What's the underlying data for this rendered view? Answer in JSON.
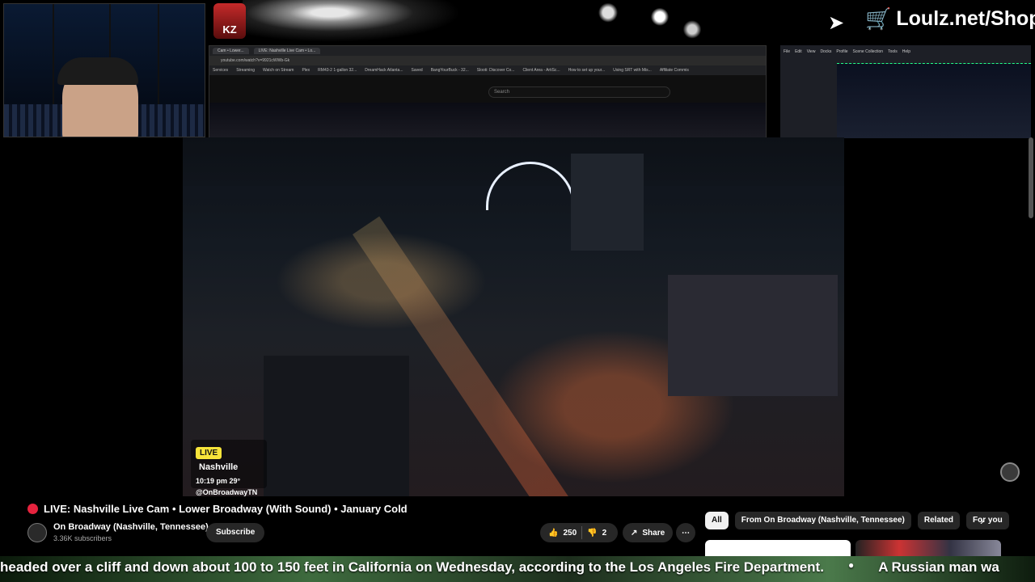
{
  "top_bar": {
    "avatar_badge": "KZ",
    "shop_label": "Loulz.net/Shop"
  },
  "browser_capture": {
    "tabs": [
      "Cam • Lower...",
      "LIVE: Nashville Live Cam • Lo..."
    ],
    "url": "youtube.com/watch?v=9921cWWb-Gk",
    "bookmarks": [
      "Services",
      "Streaming",
      "Watch on Stream",
      "Plex",
      "RM43-2 1-gallon 32...",
      "DreamHack Atlanta...",
      "Saved",
      "BangYourBuck - 32...",
      "Slooti: Discover Co...",
      "Client Area - ArtiSc...",
      "How to set up your...",
      "Using SRT with Mis...",
      "Affiliate Commis"
    ],
    "search_placeholder": "Search"
  },
  "obs_capture": {
    "menu": [
      "File",
      "Edit",
      "View",
      "Docks",
      "Profile",
      "Scene Collection",
      "Tools",
      "Help"
    ]
  },
  "video_overlay": {
    "live_label": "LIVE",
    "city": "Nashville",
    "time": "10:19 pm",
    "temp": "29°",
    "handle": "@OnBroadwayTN"
  },
  "video_info": {
    "title": "LIVE: Nashville Live Cam • Lower Broadway (With Sound) • January Cold",
    "channel_name": "On Broadway (Nashville, Tennessee)",
    "subscribers": "3.36K subscribers",
    "subscribe_label": "Subscribe",
    "likes": "250",
    "dislikes": "2",
    "share_label": "Share"
  },
  "chips": [
    "All",
    "From On Broadway (Nashville, Tennessee)",
    "Related",
    "For you"
  ],
  "ticker": {
    "items": [
      "headed over a cliff and down about 100 to 150 feet in California on Wednesday, according to the Los Angeles Fire Department.",
      "A Russian man wa"
    ]
  },
  "colors": {
    "live_dot": "#e6233e",
    "live_pill": "#f7e43a",
    "pill_bg": "#272727"
  },
  "icons": [
    "cursor-icon",
    "cart-icon",
    "like-icon",
    "dislike-icon",
    "share-icon",
    "more-icon",
    "chevron-right-icon",
    "live-dot-icon"
  ]
}
